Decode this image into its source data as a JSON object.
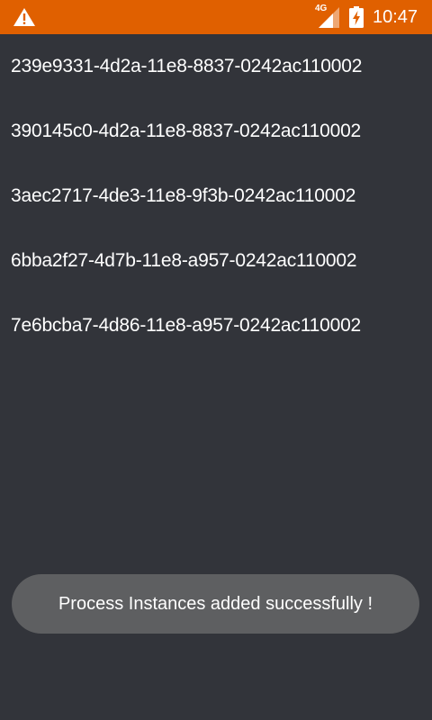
{
  "status_bar": {
    "background": "#e06000",
    "network_label": "4G",
    "time": "10:47",
    "icons": [
      "warning-icon",
      "cellular-signal-icon",
      "battery-charging-icon"
    ]
  },
  "list": {
    "items": [
      {
        "label": "239e9331-4d2a-11e8-8837-0242ac110002"
      },
      {
        "label": "390145c0-4d2a-11e8-8837-0242ac110002"
      },
      {
        "label": "3aec2717-4de3-11e8-9f3b-0242ac110002"
      },
      {
        "label": "6bba2f27-4d7b-11e8-a957-0242ac110002"
      },
      {
        "label": "7e6bcba7-4d86-11e8-a957-0242ac110002"
      }
    ]
  },
  "toast": {
    "message": "Process Instances added successfully !"
  },
  "colors": {
    "background": "#32343a",
    "toast_background": "#5e5f61",
    "text": "#ffffff"
  }
}
